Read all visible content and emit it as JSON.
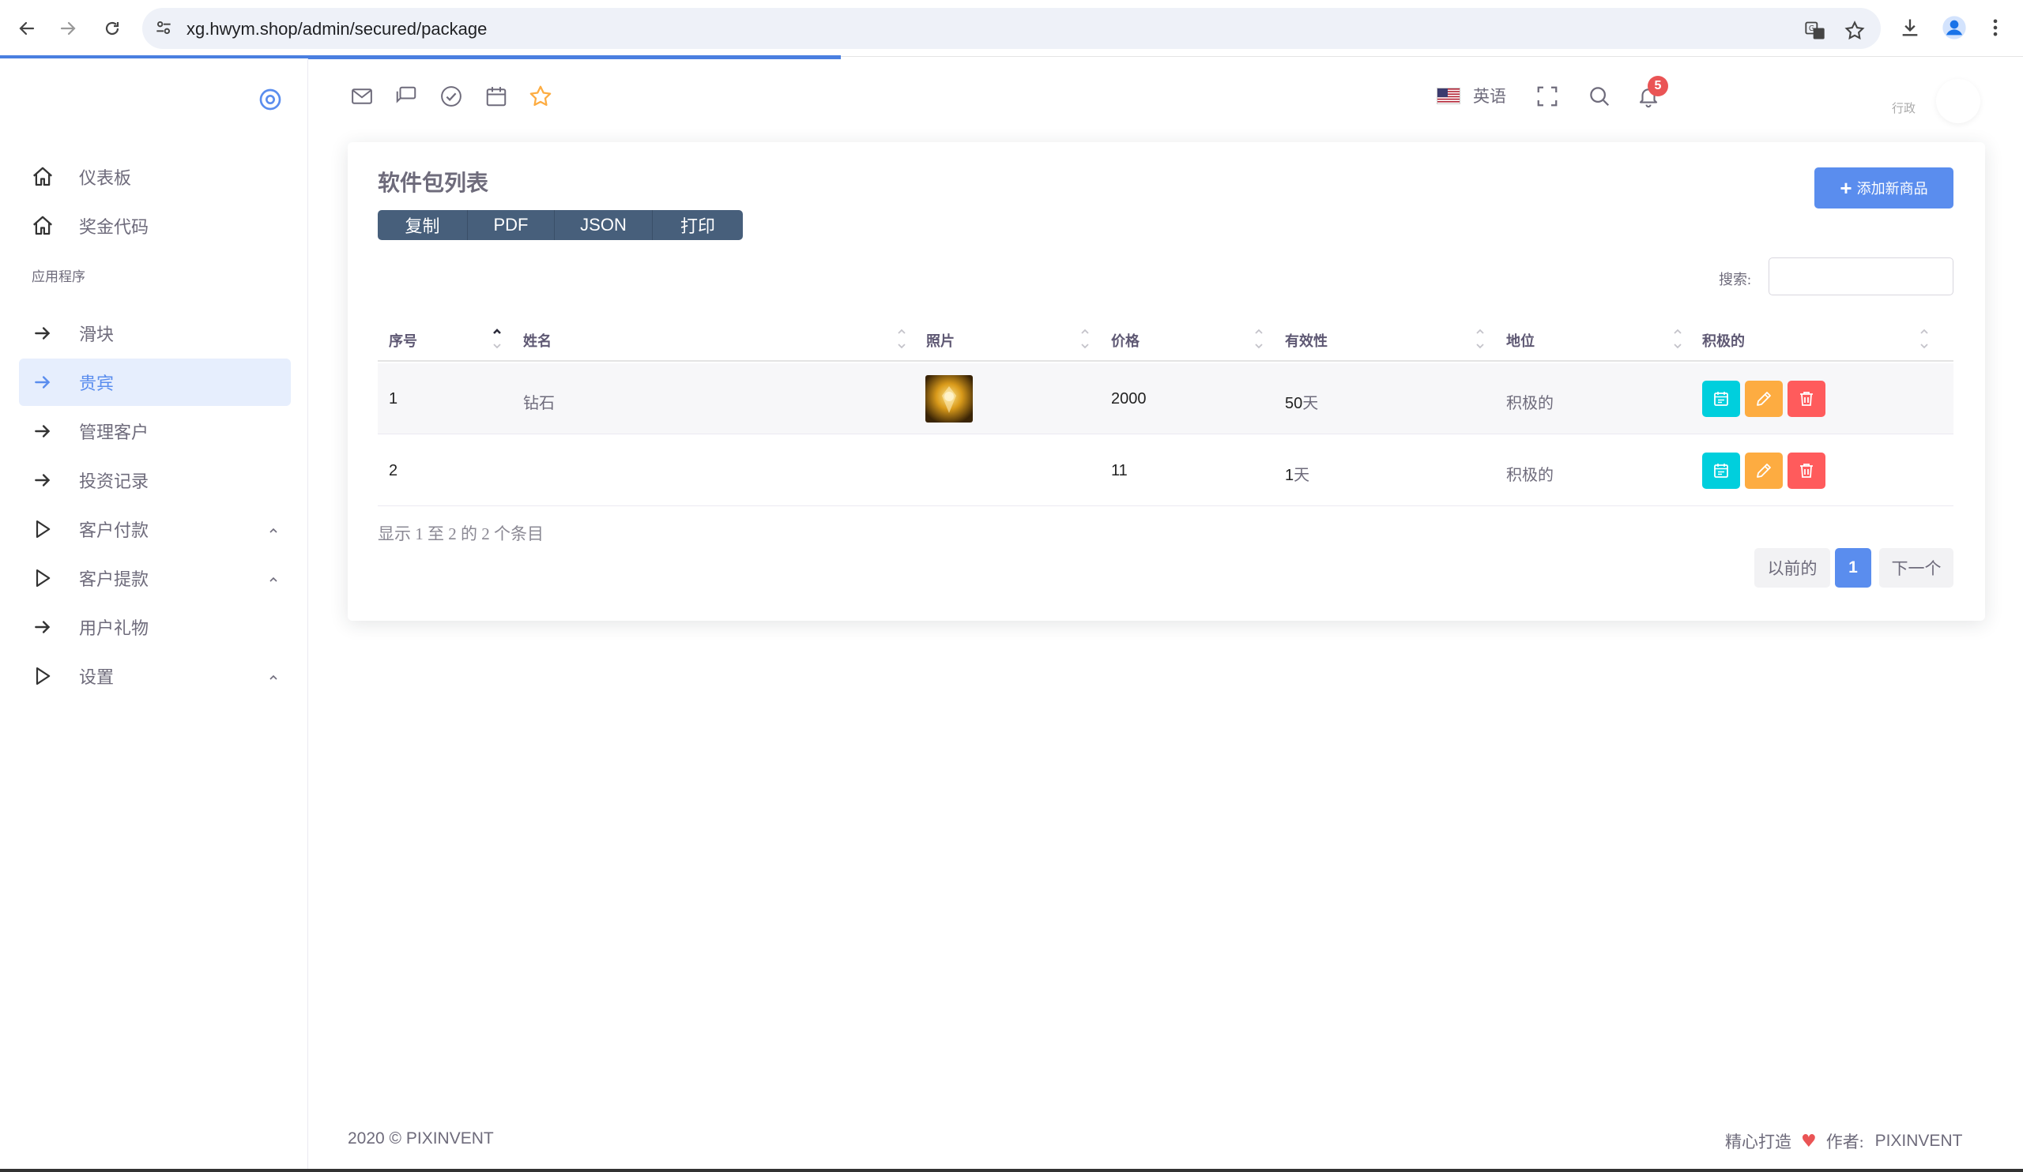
{
  "browser": {
    "url": "xg.hwym.shop/admin/secured/package"
  },
  "sidebar": {
    "items": [
      {
        "label": "仪表板",
        "icon": "home-icon"
      },
      {
        "label": "奖金代码",
        "icon": "home-icon"
      },
      {
        "label": "滑块",
        "icon": "arrow-right-icon"
      },
      {
        "label": "贵宾",
        "icon": "arrow-right-icon",
        "active": true
      },
      {
        "label": "管理客户",
        "icon": "arrow-right-icon"
      },
      {
        "label": "投资记录",
        "icon": "arrow-right-icon"
      },
      {
        "label": "客户付款",
        "icon": "play-icon",
        "expandable": true
      },
      {
        "label": "客户提款",
        "icon": "play-icon",
        "expandable": true
      },
      {
        "label": "用户礼物",
        "icon": "arrow-right-icon"
      },
      {
        "label": "设置",
        "icon": "play-icon",
        "expandable": true
      }
    ],
    "section_title": "应用程序"
  },
  "navbar": {
    "language": "英语",
    "notification_count": "5",
    "user_label": "行政"
  },
  "card": {
    "title": "软件包列表",
    "export_buttons": [
      "复制",
      "PDF",
      "JSON",
      "打印"
    ],
    "add_button": "添加新商品",
    "search_label": "搜索:",
    "search_value": ""
  },
  "table": {
    "columns": [
      "序号",
      "姓名",
      "照片",
      "价格",
      "有效性",
      "地位",
      "积极的"
    ],
    "rows": [
      {
        "id": "1",
        "name": "钻石",
        "has_photo": true,
        "price": "2000",
        "validity_num": "50",
        "validity_unit": "天",
        "status": "积极的"
      },
      {
        "id": "2",
        "name": "",
        "has_photo": false,
        "price": "11",
        "validity_num": "1",
        "validity_unit": "天",
        "status": "积极的"
      }
    ],
    "info": "显示 1 至 2 的 2 个条目",
    "pagination": {
      "prev": "以前的",
      "current": "1",
      "next": "下一个"
    }
  },
  "footer": {
    "copyright": "2020 © PIXINVENT",
    "made_with": "精心打造",
    "by": "作者:",
    "brand": "PIXINVENT"
  },
  "colors": {
    "primary": "#5a8dee",
    "info": "#00cfdd",
    "warning": "#fdac41",
    "danger": "#ff5b5c",
    "dark_button": "#475f7b"
  }
}
